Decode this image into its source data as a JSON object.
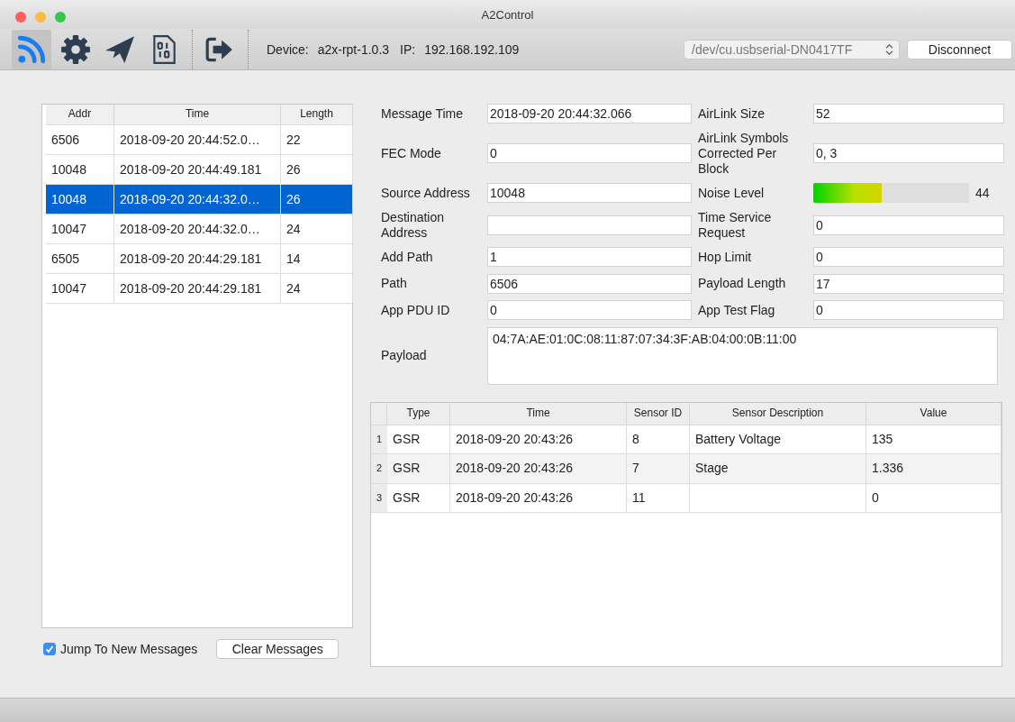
{
  "window": {
    "title": "A2Control"
  },
  "toolbar": {
    "tools": [
      {
        "kind": "feed",
        "selected": true
      },
      {
        "kind": "settings",
        "selected": false
      },
      {
        "kind": "send",
        "selected": false
      },
      {
        "kind": "binary",
        "selected": false
      },
      {
        "kind": "exit",
        "selected": false
      }
    ],
    "device": {
      "label": "Device:",
      "value": "a2x-rpt-1.0.3"
    },
    "ip": {
      "label": "IP:",
      "value": "192.168.192.109"
    },
    "port_select": {
      "value": "/dev/cu.usbserial-DN0417TF"
    },
    "disconnect_button": "Disconnect"
  },
  "messages": {
    "columns": [
      "Addr",
      "Time",
      "Length"
    ],
    "rows": [
      {
        "cells": [
          "6506",
          "2018-09-20 20:44:52.0…",
          "22"
        ],
        "selected": false
      },
      {
        "cells": [
          "10048",
          "2018-09-20 20:44:49.181",
          "26"
        ],
        "selected": false
      },
      {
        "cells": [
          "10048",
          "2018-09-20 20:44:32.0…",
          "26"
        ],
        "selected": true
      },
      {
        "cells": [
          "10047",
          "2018-09-20 20:44:32.0…",
          "24"
        ],
        "selected": false
      },
      {
        "cells": [
          "6505",
          "2018-09-20 20:44:29.181",
          "14"
        ],
        "selected": false
      },
      {
        "cells": [
          "10047",
          "2018-09-20 20:44:29.181",
          "24"
        ],
        "selected": false
      }
    ]
  },
  "jump_checkbox": {
    "label": "Jump To New Messages",
    "checked": true
  },
  "clear_button": "Clear Messages",
  "details": {
    "rows": [
      {
        "left": {
          "label": "Message Time",
          "value": "2018-09-20 20:44:32.066"
        },
        "right": {
          "kind": "text",
          "label": "AirLink Size",
          "value": "52"
        }
      },
      {
        "left": {
          "label": "FEC Mode",
          "value": "0"
        },
        "right": {
          "kind": "text",
          "label": "AirLink Symbols Corrected Per Block",
          "value": "0, 3"
        }
      },
      {
        "left": {
          "label": "Source Address",
          "value": "10048"
        },
        "right": {
          "kind": "meter",
          "label": "Noise Level",
          "level": 0.44,
          "reading": "44"
        }
      },
      {
        "left": {
          "label": "Destination Address"
        },
        "right": {
          "kind": "text",
          "label": "Time Service Request",
          "value": "0"
        }
      },
      {
        "left": {
          "label": "Add Path",
          "value": "1"
        },
        "right": {
          "kind": "text",
          "label": "Hop Limit",
          "value": "0"
        }
      },
      {
        "left": {
          "label": "Path",
          "value": "6506"
        },
        "right": {
          "kind": "text",
          "label": "Payload Length",
          "value": "17"
        }
      },
      {
        "left": {
          "label": "App PDU ID",
          "value": "0"
        },
        "right": {
          "kind": "text",
          "label": "App Test Flag",
          "value": "0"
        }
      }
    ],
    "payload": {
      "label": "Payload",
      "value": "04:7A:AE:01:0C:08:11:87:07:34:3F:AB:04:00:0B:11:00"
    }
  },
  "sensors": {
    "columns": [
      "Type",
      "Time",
      "Sensor ID",
      "Sensor Description",
      "Value"
    ],
    "rows": [
      {
        "number": "1",
        "cells": [
          "GSR",
          "2018-09-20 20:43:26",
          "8",
          "Battery Voltage",
          "135"
        ]
      },
      {
        "number": "2",
        "cells": [
          "GSR",
          "2018-09-20 20:43:26",
          "7",
          "Stage",
          "1.336"
        ]
      },
      {
        "number": "3",
        "cells": [
          "GSR",
          "2018-09-20 20:43:26",
          "11",
          null,
          "0"
        ]
      }
    ]
  }
}
